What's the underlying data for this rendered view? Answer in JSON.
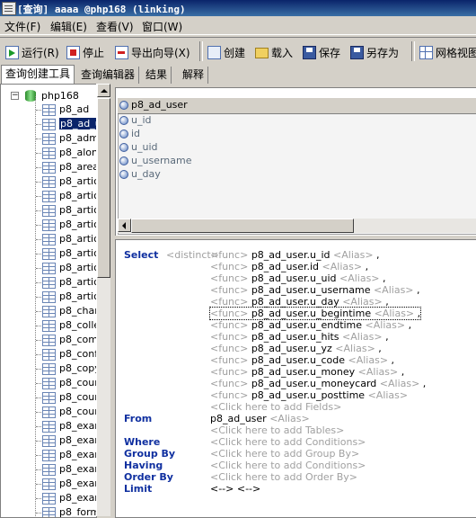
{
  "title": "[查询] aaaa @php168 (linking)",
  "menu": [
    "文件(F)",
    "编辑(E)",
    "查看(V)",
    "窗口(W)"
  ],
  "toolbar": {
    "run": "运行(R)",
    "stop": "停止",
    "export": "导出向导(X)",
    "create": "创建",
    "load": "载入",
    "save": "保存",
    "save_as": "另存为",
    "grid_view": "网格视图"
  },
  "tabs": [
    "查询创建工具",
    "查询编辑器",
    "结果",
    "解释"
  ],
  "tree": {
    "db": "php168",
    "tables": [
      "p8_ad",
      "p8_ad_u",
      "p8_adm",
      "p8_alon",
      "p8_area",
      "p8_artic",
      "p8_artic",
      "p8_artic",
      "p8_artic",
      "p8_artic",
      "p8_artic",
      "p8_artic",
      "p8_artic",
      "p8_artic",
      "p8_char",
      "p8_colle",
      "p8_comr",
      "p8_conf",
      "p8_copy",
      "p8_cour",
      "p8_cour",
      "p8_cour",
      "p8_exar",
      "p8_exar",
      "p8_exar",
      "p8_exar",
      "p8_exar",
      "p8_exar",
      "p8_form"
    ],
    "selected_index": 1
  },
  "table_box": {
    "name": "p8_ad_user",
    "fields": [
      "u_id",
      "id",
      "u_uid",
      "u_username",
      "u_day"
    ]
  },
  "sql": {
    "select_kw": "Select",
    "distinct": "<distinct>",
    "func": "<func>",
    "alias": "<Alias>",
    "columns": [
      "p8_ad_user.u_id",
      "p8_ad_user.id",
      "p8_ad_user.u_uid",
      "p8_ad_user.u_username",
      "p8_ad_user.u_day",
      "p8_ad_user.u_begintime",
      "p8_ad_user.u_endtime",
      "p8_ad_user.u_hits",
      "p8_ad_user.u_yz",
      "p8_ad_user.u_code",
      "p8_ad_user.u_money",
      "p8_ad_user.u_moneycard",
      "p8_ad_user.u_posttime"
    ],
    "add_fields": "<Click here to add Fields>",
    "from_kw": "From",
    "from_table": "p8_ad_user",
    "add_tables": "<Click here to add Tables>",
    "where_kw": "Where",
    "add_conditions": "<Click here to add Conditions>",
    "group_kw": "Group By",
    "add_group": "<Click here to add Group By>",
    "having_kw": "Having",
    "order_kw": "Order By",
    "add_order": "<Click here to add Order By>",
    "limit_kw": "Limit",
    "limit_val": "<--> <-->"
  }
}
